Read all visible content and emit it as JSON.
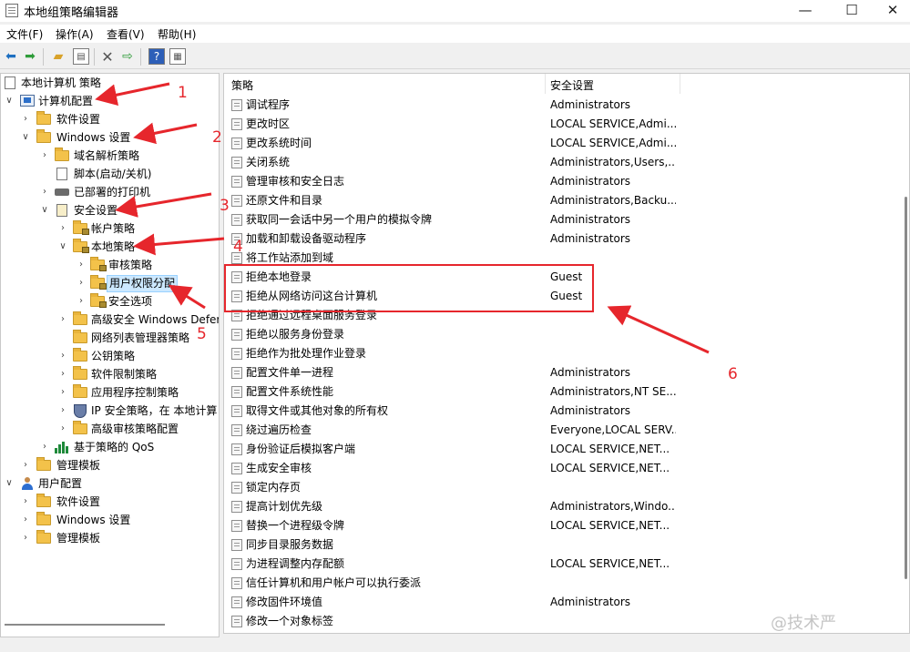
{
  "window": {
    "title": "本地组策略编辑器",
    "controls": {
      "minimize": "—",
      "maximize": "☐",
      "close": "✕"
    }
  },
  "menu": [
    {
      "label": "文件(F)"
    },
    {
      "label": "操作(A)"
    },
    {
      "label": "查看(V)"
    },
    {
      "label": "帮助(H)"
    }
  ],
  "toolbar": {
    "icons": [
      "back-icon",
      "forward-icon",
      "up-folder-icon",
      "show-tree-icon",
      "delete-icon",
      "export-icon",
      "help-icon",
      "properties-icon"
    ]
  },
  "tree": {
    "root": "本地计算机 策略",
    "items": [
      {
        "label": "计算机配置",
        "expander": "∨",
        "icon": "computer-icon"
      },
      {
        "label": "软件设置",
        "expander": "›",
        "icon": "folder-icon"
      },
      {
        "label": "Windows 设置",
        "expander": "∨",
        "icon": "folder-icon"
      },
      {
        "label": "域名解析策略",
        "expander": "›",
        "icon": "folder-icon"
      },
      {
        "label": "脚本(启动/关机)",
        "expander": "",
        "icon": "script-icon"
      },
      {
        "label": "已部署的打印机",
        "expander": "›",
        "icon": "printer-icon"
      },
      {
        "label": "安全设置",
        "expander": "∨",
        "icon": "security-icon"
      },
      {
        "label": "帐户策略",
        "expander": "›",
        "icon": "folder-lock-icon"
      },
      {
        "label": "本地策略",
        "expander": "∨",
        "icon": "folder-lock-icon"
      },
      {
        "label": "审核策略",
        "expander": "›",
        "icon": "folder-lock-icon"
      },
      {
        "label": "用户权限分配",
        "expander": "›",
        "icon": "folder-lock-icon",
        "selected": true
      },
      {
        "label": "安全选项",
        "expander": "›",
        "icon": "folder-lock-icon"
      },
      {
        "label": "高级安全 Windows Defer",
        "expander": "›",
        "icon": "folder-icon"
      },
      {
        "label": "网络列表管理器策略",
        "expander": "",
        "icon": "folder-icon"
      },
      {
        "label": "公钥策略",
        "expander": "›",
        "icon": "folder-icon"
      },
      {
        "label": "软件限制策略",
        "expander": "›",
        "icon": "folder-icon"
      },
      {
        "label": "应用程序控制策略",
        "expander": "›",
        "icon": "folder-icon"
      },
      {
        "label": "IP 安全策略，在 本地计算",
        "expander": "›",
        "icon": "shield-icon"
      },
      {
        "label": "高级审核策略配置",
        "expander": "›",
        "icon": "folder-icon"
      },
      {
        "label": "基于策略的 QoS",
        "expander": "›",
        "icon": "chart-icon"
      },
      {
        "label": "管理模板",
        "expander": "›",
        "icon": "folder-icon"
      },
      {
        "label": "用户配置",
        "expander": "∨",
        "icon": "user-icon"
      },
      {
        "label": "软件设置",
        "expander": "›",
        "icon": "folder-icon"
      },
      {
        "label": "Windows 设置",
        "expander": "›",
        "icon": "folder-icon"
      },
      {
        "label": "管理模板",
        "expander": "›",
        "icon": "folder-icon"
      }
    ]
  },
  "list": {
    "columns": {
      "policy": "策略",
      "setting": "安全设置"
    },
    "rows": [
      {
        "name": "调试程序",
        "value": "Administrators"
      },
      {
        "name": "更改时区",
        "value": "LOCAL SERVICE,Admi..."
      },
      {
        "name": "更改系统时间",
        "value": "LOCAL SERVICE,Admi..."
      },
      {
        "name": "关闭系统",
        "value": "Administrators,Users,..."
      },
      {
        "name": "管理审核和安全日志",
        "value": "Administrators"
      },
      {
        "name": "还原文件和目录",
        "value": "Administrators,Backu..."
      },
      {
        "name": "获取同一会话中另一个用户的模拟令牌",
        "value": "Administrators"
      },
      {
        "name": "加载和卸载设备驱动程序",
        "value": "Administrators"
      },
      {
        "name": "将工作站添加到域",
        "value": ""
      },
      {
        "name": "拒绝本地登录",
        "value": "Guest"
      },
      {
        "name": "拒绝从网络访问这台计算机",
        "value": "Guest"
      },
      {
        "name": "拒绝通过远程桌面服务登录",
        "value": ""
      },
      {
        "name": "拒绝以服务身份登录",
        "value": ""
      },
      {
        "name": "拒绝作为批处理作业登录",
        "value": ""
      },
      {
        "name": "配置文件单一进程",
        "value": "Administrators"
      },
      {
        "name": "配置文件系统性能",
        "value": "Administrators,NT SE..."
      },
      {
        "name": "取得文件或其他对象的所有权",
        "value": "Administrators"
      },
      {
        "name": "绕过遍历检查",
        "value": "Everyone,LOCAL SERV..."
      },
      {
        "name": "身份验证后模拟客户端",
        "value": "LOCAL SERVICE,NET..."
      },
      {
        "name": "生成安全审核",
        "value": "LOCAL SERVICE,NET..."
      },
      {
        "name": "锁定内存页",
        "value": ""
      },
      {
        "name": "提高计划优先级",
        "value": "Administrators,Windo..."
      },
      {
        "name": "替换一个进程级令牌",
        "value": "LOCAL SERVICE,NET..."
      },
      {
        "name": "同步目录服务数据",
        "value": ""
      },
      {
        "name": "为进程调整内存配额",
        "value": "LOCAL SERVICE,NET..."
      },
      {
        "name": "信任计算机和用户帐户可以执行委派",
        "value": ""
      },
      {
        "name": "修改固件环境值",
        "value": "Administrators"
      },
      {
        "name": "修改一个对象标签",
        "value": ""
      }
    ]
  },
  "annotations": {
    "numbers": [
      "1",
      "2",
      "3",
      "4",
      "5",
      "6"
    ],
    "color": "#e6262c"
  },
  "watermark": "@技术严"
}
